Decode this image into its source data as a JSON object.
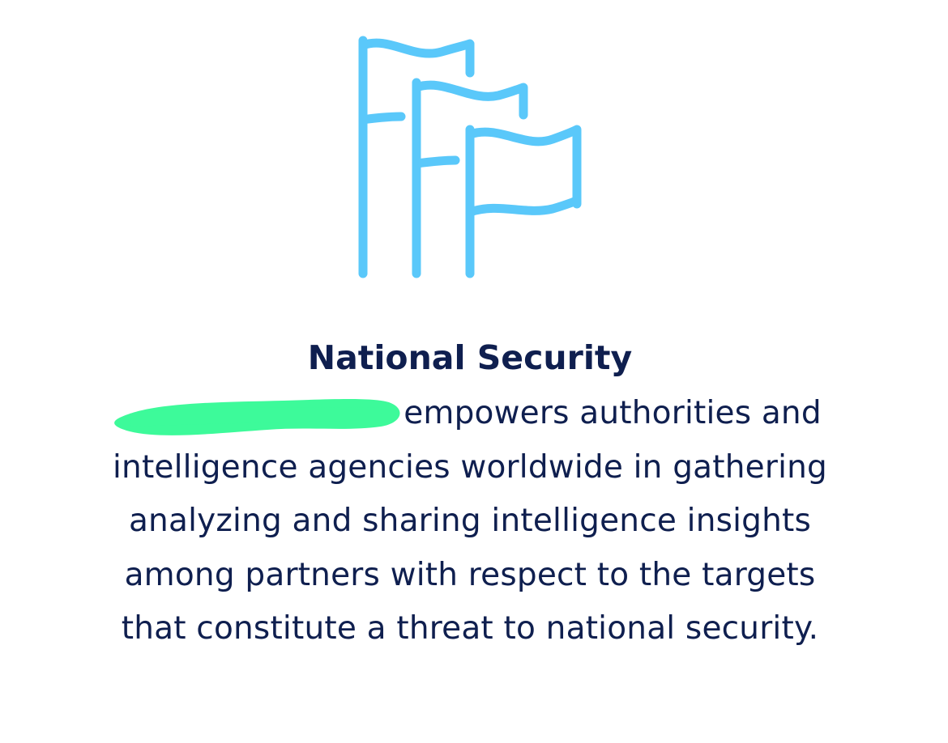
{
  "colors": {
    "icon_stroke": "#5ac8fa",
    "text": "#0f1f4f",
    "redaction": "#3dfa9a",
    "background": "#ffffff"
  },
  "icon": {
    "name": "flags-icon"
  },
  "title": "National Security",
  "body": {
    "line1_visible": "empowers authorities and",
    "line2": "intelligence agencies worldwide in gathering",
    "line3": "analyzing and sharing intelligence insights",
    "line4": "among partners with respect to the targets",
    "line5": "that constitute a threat to national security."
  }
}
